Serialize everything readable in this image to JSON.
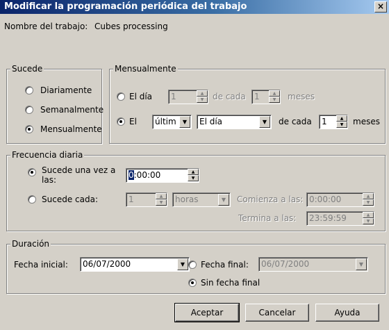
{
  "window": {
    "title": "Modificar la programación periódica del trabajo",
    "close_label": "×"
  },
  "job": {
    "label": "Nombre del trabajo:",
    "name": "Cubes processing"
  },
  "occurs": {
    "legend": "Sucede",
    "options": [
      "Diariamente",
      "Semanalmente",
      "Mensualmente"
    ],
    "selected": "Mensualmente"
  },
  "monthly": {
    "legend": "Mensualmente",
    "day_option": {
      "label": "El día",
      "day_value": "1",
      "every_label": "de cada",
      "months_value": "1",
      "months_label": "meses"
    },
    "the_option": {
      "label": "El",
      "ordinal": "últim",
      "day_kind": "El día",
      "every_label": "de cada",
      "months_value": "1",
      "months_label": "meses"
    }
  },
  "daily": {
    "legend": "Frecuencia diaria",
    "once_label": "Sucede una vez a las:",
    "once_time": "0:00:00",
    "once_time_cursor": "0",
    "every_label": "Sucede cada:",
    "every_value": "1",
    "every_unit": "horas",
    "start_label": "Comienza a las:",
    "start_time": "0:00:00",
    "end_label": "Termina a las:",
    "end_time": "23:59:59"
  },
  "duration": {
    "legend": "Duración",
    "start_label": "Fecha inicial:",
    "start_date": "06/07/2000",
    "end_label": "Fecha final:",
    "end_date": "06/07/2000",
    "no_end_label": "Sin fecha final"
  },
  "buttons": {
    "ok": "Aceptar",
    "cancel": "Cancelar",
    "help": "Ayuda"
  }
}
